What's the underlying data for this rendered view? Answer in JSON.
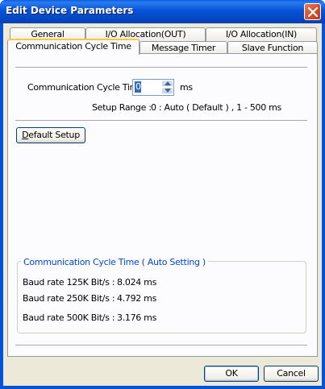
{
  "window": {
    "title": "Edit Device Parameters"
  },
  "tabs": {
    "row1": [
      "General",
      "I/O Allocation(OUT)",
      "I/O Allocation(IN)"
    ],
    "row2": [
      "Communication Cycle Time",
      "Message Timer",
      "Slave Function"
    ],
    "active": "Communication Cycle Time"
  },
  "cycle_time": {
    "label": "Communication Cycle Time :",
    "value": "0",
    "unit": "ms",
    "setup_range_label": "Setup Range :",
    "setup_range_value": "0 : Auto ( Default ) ,  1 - 500 ms"
  },
  "default_setup": {
    "label_first": "D",
    "label_rest": "efault Setup"
  },
  "auto_setting": {
    "group_title": "Communication Cycle Time ( Auto Setting )",
    "rows": [
      {
        "label": "Baud rate 125K Bit/s :",
        "value": "8.024 ms"
      },
      {
        "label": "Baud rate 250K Bit/s :",
        "value": "4.792 ms"
      },
      {
        "label": "Baud rate 500K Bit/s :",
        "value": "3.176 ms"
      }
    ]
  },
  "buttons": {
    "ok": "OK",
    "cancel": "Cancel"
  },
  "colors": {
    "titlebar": "#0753D7",
    "client_bg": "#ECE9D8",
    "group_title": "#0046D5",
    "close_button": "#D8522F",
    "active_tab_highlight": "#FFC83C"
  },
  "icons": {
    "close": "close-icon",
    "spin_up": "spin-up-arrow-icon",
    "spin_down": "spin-down-arrow-icon"
  }
}
